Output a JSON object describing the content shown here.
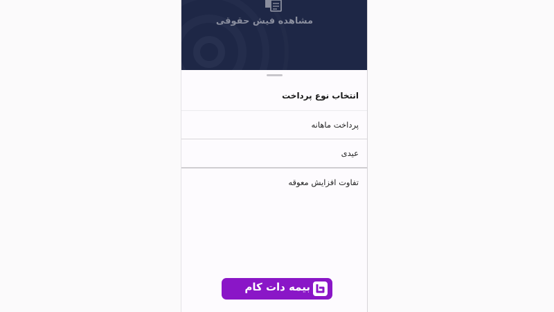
{
  "header": {
    "title": "مشاهده فیش حقوقی",
    "icon": "payslip-icon",
    "background": "#1e2746"
  },
  "sheet": {
    "title": "انتخاب نوع پرداخت",
    "options": [
      {
        "label": "پرداخت ماهانه"
      },
      {
        "label": "عیدی"
      },
      {
        "label": "تفاوت افزایش معوقه"
      }
    ]
  },
  "watermark": {
    "text": "بیمه دات کام",
    "background": "#8a16c7"
  }
}
